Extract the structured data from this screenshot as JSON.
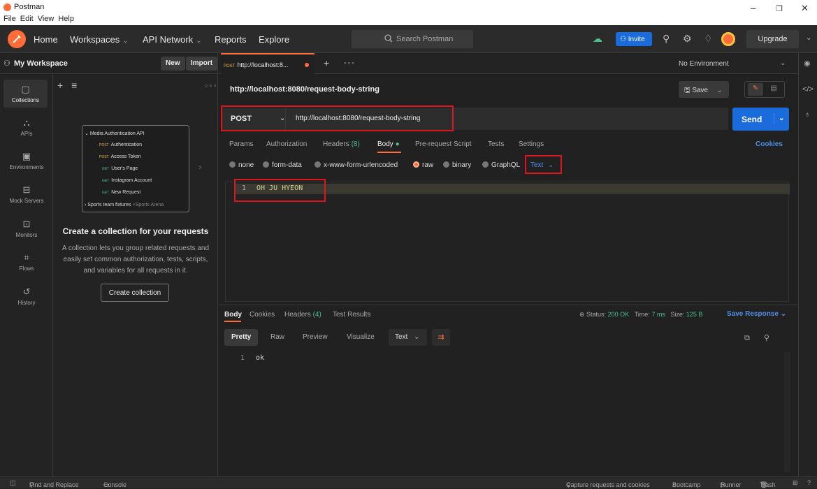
{
  "window": {
    "title": "Postman",
    "menu": [
      "File",
      "Edit",
      "View",
      "Help"
    ],
    "controls": {
      "minimize": "–",
      "restore": "❐",
      "close": "✕"
    }
  },
  "topnav": {
    "home": "Home",
    "workspaces": "Workspaces",
    "api_network": "API Network",
    "reports": "Reports",
    "explore": "Explore",
    "search_placeholder": "Search Postman",
    "invite": "Invite",
    "upgrade": "Upgrade"
  },
  "sidebar": {
    "workspace_name": "My Workspace",
    "new_label": "New",
    "import_label": "Import",
    "rail": [
      {
        "label": "Collections",
        "icon": "collections-icon",
        "glyph": "▢"
      },
      {
        "label": "APIs",
        "icon": "apis-icon",
        "glyph": "⛬"
      },
      {
        "label": "Environments",
        "icon": "environments-icon",
        "glyph": "▣"
      },
      {
        "label": "Mock Servers",
        "icon": "mock-servers-icon",
        "glyph": "⊟"
      },
      {
        "label": "Monitors",
        "icon": "monitors-icon",
        "glyph": "⊡"
      },
      {
        "label": "Flows",
        "icon": "flows-icon",
        "glyph": "⌗"
      },
      {
        "label": "History",
        "icon": "history-icon",
        "glyph": "↺"
      }
    ],
    "preview": {
      "collection": "Media Authentication API",
      "items": [
        {
          "method": "POST",
          "name": "Authentication"
        },
        {
          "method": "POST",
          "name": "Access Token"
        },
        {
          "method": "GET",
          "name": "User's Page"
        },
        {
          "method": "GET",
          "name": "Instagram Account"
        },
        {
          "method": "GET",
          "name": "New Request"
        }
      ],
      "fork_name": "Sports team fixtures",
      "fork_source": "Sports Arena"
    },
    "empty_title": "Create a collection for your requests",
    "empty_desc": "A collection lets you group related requests and easily set common authorization, tests, scripts, and variables for all requests in it.",
    "create_button": "Create collection"
  },
  "tabs": {
    "active_tab": {
      "method": "POST",
      "label": "http://localhost:8..."
    },
    "environment": "No Environment"
  },
  "request": {
    "title": "http://localhost:8080/request-body-string",
    "save_label": "Save",
    "method": "POST",
    "url": "http://localhost:8080/request-body-string",
    "send_label": "Send",
    "tabs": {
      "params": "Params",
      "authorization": "Authorization",
      "headers": "Headers",
      "headers_count": "(8)",
      "body": "Body",
      "prerequest": "Pre-request Script",
      "tests": "Tests",
      "settings": "Settings"
    },
    "cookies": "Cookies",
    "body_modes": [
      "none",
      "form-data",
      "x-www-form-urlencoded",
      "raw",
      "binary",
      "GraphQL"
    ],
    "raw_type": "Text",
    "body_line_no": "1",
    "body_content": "OH JU HYEON"
  },
  "response": {
    "tabs": {
      "body": "Body",
      "cookies": "Cookies",
      "headers": "Headers",
      "headers_count": "(4)",
      "tests": "Test Results"
    },
    "status_label": "Status:",
    "status": "200 OK",
    "time_label": "Time:",
    "time": "7 ms",
    "size_label": "Size:",
    "size": "125 B",
    "save_response": "Save Response",
    "formats": [
      "Pretty",
      "Raw",
      "Preview",
      "Visualize"
    ],
    "format_type": "Text",
    "line_no": "1",
    "content": "ok"
  },
  "statusbar": {
    "find_replace": "Find and Replace",
    "console": "Console",
    "capture": "Capture requests and cookies",
    "bootcamp": "Bootcamp",
    "runner": "Runner",
    "trash": "Trash"
  },
  "colors": {
    "accent": "#ff6c37",
    "primary": "#1a6bdc",
    "highlight": "#e0141b",
    "success": "#49c08b"
  }
}
